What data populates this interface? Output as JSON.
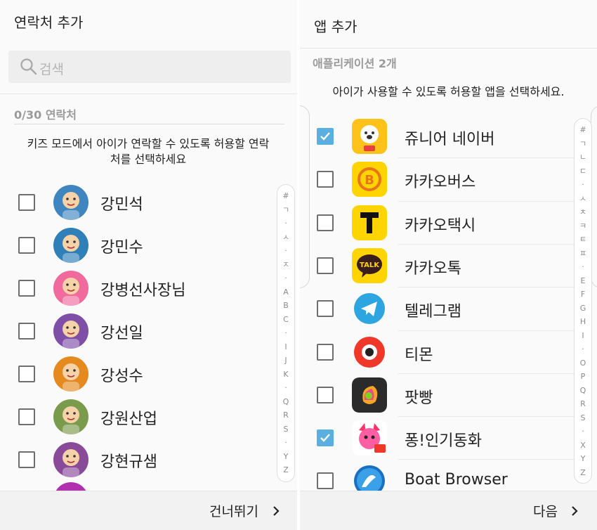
{
  "left": {
    "title": "연락처 추가",
    "search_placeholder": "검색",
    "count_label": "0/30 연락처",
    "description": "키즈 모드에서 아이가 연락할 수 있도록 허용할 연락처를 선택하세요",
    "contacts": [
      {
        "name": "강민석",
        "checked": false,
        "avatar_color": "#3f86c0"
      },
      {
        "name": "강민수",
        "checked": false,
        "avatar_color": "#2f7fb8"
      },
      {
        "name": "강병선사장님",
        "checked": false,
        "avatar_color": "#f06a9e"
      },
      {
        "name": "강선일",
        "checked": false,
        "avatar_color": "#7f4fa8"
      },
      {
        "name": "강성수",
        "checked": false,
        "avatar_color": "#e58a1f"
      },
      {
        "name": "강원산업",
        "checked": false,
        "avatar_color": "#7a9a4c"
      },
      {
        "name": "강현규샘",
        "checked": false,
        "avatar_color": "#8a4a9a"
      }
    ],
    "index_letters": [
      "#",
      "ㄱ",
      "·",
      "ㅅ",
      "·",
      "ㅈ",
      "·",
      "A",
      "B",
      "C",
      "·",
      "I",
      "J",
      "K",
      "·",
      "Q",
      "R",
      "S",
      "·",
      "Y",
      "Z"
    ],
    "skip_label": "건너뛰기"
  },
  "right": {
    "title": "앱 추가",
    "count_label": "애플리케이션 2개",
    "description": "아이가 사용할 수 있도록 허용할 앱을 선택하세요.",
    "apps": [
      {
        "name": "쥬니어 네이버",
        "checked": true,
        "icon": "junior-naver-icon"
      },
      {
        "name": "카카오버스",
        "checked": false,
        "icon": "kakaobus-icon"
      },
      {
        "name": "카카오택시",
        "checked": false,
        "icon": "kakaotaxi-icon"
      },
      {
        "name": "카카오톡",
        "checked": false,
        "icon": "kakaotalk-icon"
      },
      {
        "name": "텔레그램",
        "checked": false,
        "icon": "telegram-icon"
      },
      {
        "name": "티몬",
        "checked": false,
        "icon": "tmon-icon"
      },
      {
        "name": "팟빵",
        "checked": false,
        "icon": "podbbang-icon"
      },
      {
        "name": "퐁!인기동화",
        "checked": true,
        "icon": "pinkfong-icon"
      },
      {
        "name": "Boat Browser",
        "checked": false,
        "icon": "boat-browser-icon"
      }
    ],
    "index_letters": [
      "#",
      "ㄱ",
      "ㄴ",
      "ㄷ",
      "·",
      "ㅅ",
      "ㅊ",
      "ㅋ",
      "ㅌ",
      "ㅍ",
      "·",
      "E",
      "F",
      "G",
      "H",
      "I",
      "·",
      "O",
      "P",
      "Q",
      "R",
      "S",
      "·",
      "X",
      "Y",
      "Z"
    ],
    "kakaotalk_icon_text": "TALK",
    "next_label": "다음"
  },
  "colors": {
    "checkbox_checked": "#5aaee0",
    "kakao_yellow": "#ffd400",
    "telegram_blue": "#2ca5e0",
    "tmon_red": "#f0382a"
  }
}
